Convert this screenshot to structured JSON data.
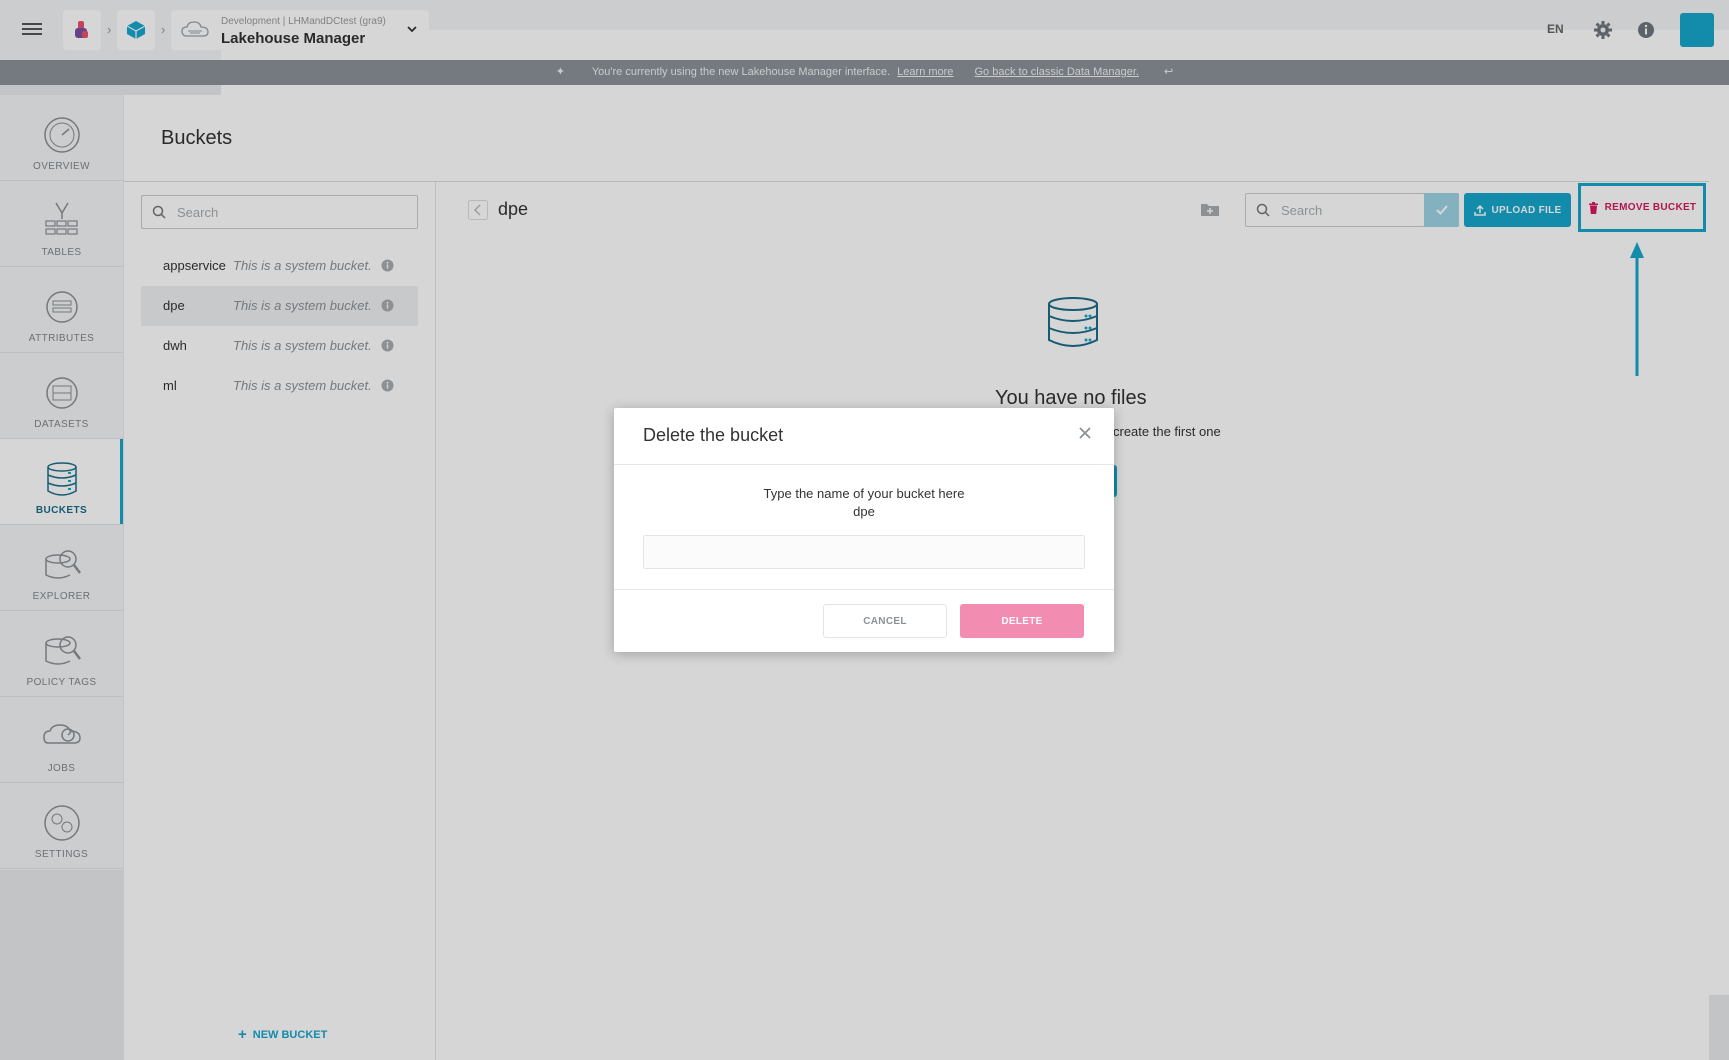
{
  "topbar": {
    "env_label": "Development | LHMandDCtest (gra9)",
    "app_name": "Lakehouse Manager",
    "language": "EN",
    "icons": [
      "menu-icon",
      "logo-icon",
      "cube-icon",
      "cloud-icon",
      "chevron-down-icon",
      "gear-icon",
      "info-icon"
    ]
  },
  "banner": {
    "text": "You're currently using the new Lakehouse Manager interface.",
    "learn_more": "Learn more",
    "back_link": "Go back to classic Data Manager."
  },
  "sidebar": {
    "items": [
      {
        "label": "OVERVIEW",
        "icon": "gauge-icon"
      },
      {
        "label": "TABLES",
        "icon": "tables-icon"
      },
      {
        "label": "ATTRIBUTES",
        "icon": "attributes-icon"
      },
      {
        "label": "DATASETS",
        "icon": "datasets-icon"
      },
      {
        "label": "BUCKETS",
        "icon": "buckets-icon",
        "active": true
      },
      {
        "label": "EXPLORER",
        "icon": "explorer-icon"
      },
      {
        "label": "POLICY TAGS",
        "icon": "policy-tags-icon"
      },
      {
        "label": "JOBS",
        "icon": "jobs-icon"
      },
      {
        "label": "SETTINGS",
        "icon": "settings-icon"
      }
    ]
  },
  "main": {
    "title": "Buckets",
    "left_search_placeholder": "Search",
    "buckets": [
      {
        "name": "appservice",
        "desc": "This is a system bucket."
      },
      {
        "name": "dpe",
        "desc": "This is a system bucket.",
        "selected": true
      },
      {
        "name": "dwh",
        "desc": "This is a system bucket."
      },
      {
        "name": "ml",
        "desc": "This is a system bucket."
      }
    ],
    "new_bucket": "NEW BUCKET",
    "current_bucket": "dpe",
    "right_search_placeholder": "Search",
    "upload_file": "UPLOAD FILE",
    "remove_bucket": "REMOVE BUCKET",
    "empty_title": "You have no files",
    "empty_sub": "create the first one"
  },
  "modal": {
    "title": "Delete the bucket",
    "prompt": "Type the name of your bucket here",
    "bucket_name": "dpe",
    "input_value": "",
    "cancel": "CANCEL",
    "delete": "DELETE"
  },
  "colors": {
    "accent": "#17a6cc",
    "danger": "#d61a5e",
    "delete_disabled": "#f28cb1"
  }
}
